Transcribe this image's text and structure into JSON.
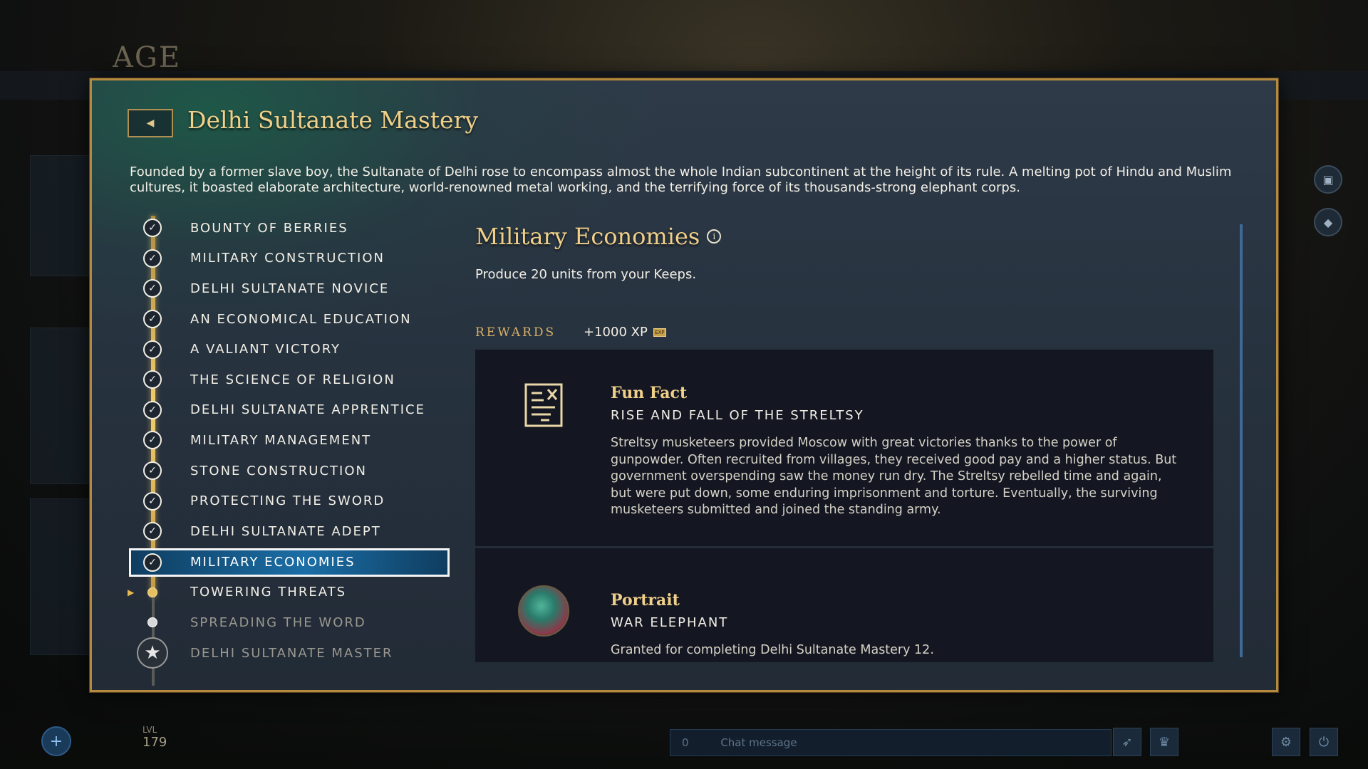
{
  "background": {
    "logo": "AGE",
    "chat_placeholder": "Chat message",
    "player_level_label": "LVL",
    "player_level": "179",
    "friends_count": "0"
  },
  "dialog": {
    "back_icon": "chevron-left-icon",
    "title": "Delhi Sultanate Mastery",
    "description": "Founded by a former slave boy, the Sultanate of Delhi rose to encompass almost the whole Indian subcontinent at the height of its rule. A melting pot of Hindu and Muslim cultures, it boasted elaborate architecture, world-renowned metal working, and the terrifying force of its thousands-strong elephant corps."
  },
  "challenges": [
    {
      "label": "BOUNTY OF BERRIES",
      "state": "done"
    },
    {
      "label": "MILITARY CONSTRUCTION",
      "state": "done"
    },
    {
      "label": "DELHI SULTANATE NOVICE",
      "state": "done"
    },
    {
      "label": "AN ECONOMICAL EDUCATION",
      "state": "done"
    },
    {
      "label": "A VALIANT VICTORY",
      "state": "done"
    },
    {
      "label": "THE SCIENCE OF RELIGION",
      "state": "done"
    },
    {
      "label": "DELHI SULTANATE APPRENTICE",
      "state": "done"
    },
    {
      "label": "MILITARY MANAGEMENT",
      "state": "done"
    },
    {
      "label": "STONE CONSTRUCTION",
      "state": "done"
    },
    {
      "label": "PROTECTING THE SWORD",
      "state": "done"
    },
    {
      "label": "DELHI SULTANATE ADEPT",
      "state": "done"
    },
    {
      "label": "MILITARY ECONOMIES",
      "state": "done",
      "selected": true
    },
    {
      "label": "TOWERING THREATS",
      "state": "current"
    },
    {
      "label": "SPREADING THE WORD",
      "state": "locked"
    },
    {
      "label": "DELHI SULTANATE MASTER",
      "state": "master"
    }
  ],
  "detail": {
    "title": "Military Economies",
    "info_icon": "info-icon",
    "description": "Produce 20 units from your Keeps.",
    "rewards_label": "REWARDS",
    "xp_reward": "+1000 XP",
    "xp_icon_text": "EXP",
    "rewards": [
      {
        "icon": "scroll-document-icon",
        "title": "Fun Fact",
        "subtitle": "RISE AND FALL OF THE STRELTSY",
        "text": "Streltsy musketeers provided Moscow with great victories thanks to the power of gunpowder. Often recruited from villages, they received good pay and a higher status. But government overspending saw the money run dry. The Streltsy rebelled time and again, but were put down, some enduring imprisonment and torture. Eventually, the surviving musketeers submitted and joined the standing army."
      },
      {
        "icon": "war-elephant-portrait",
        "title": "Portrait",
        "subtitle": "WAR ELEPHANT",
        "text": "Granted for completing Delhi Sultanate Mastery 12."
      }
    ]
  },
  "colors": {
    "gold_title": "#f0d089",
    "selected_bg": "#1b6ea6",
    "frame": "#b58a3e"
  }
}
